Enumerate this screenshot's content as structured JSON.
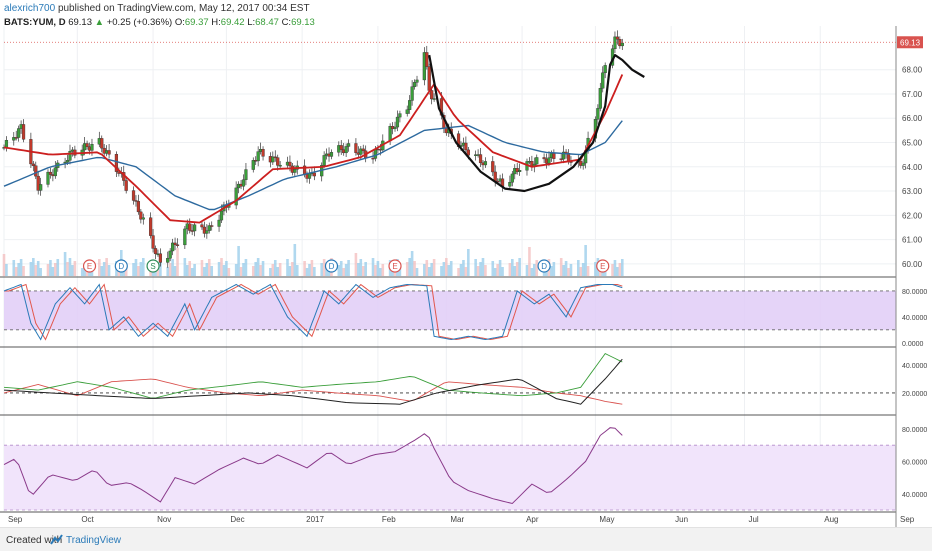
{
  "header": {
    "author": "alexrich700",
    "published": "published on TradingView.com, May 12, 2017 00:34 EST",
    "symbol": "BATS:YUM, D",
    "last": "69.13",
    "change": "+0.25 (+0.36%)",
    "open_label": "O:",
    "open": "69.37",
    "high_label": "H:",
    "high": "69.42",
    "low_label": "L:",
    "low": "68.47",
    "close_label": "C:",
    "close": "69.13"
  },
  "footer": {
    "created": "Created with",
    "brand": "TradingView"
  },
  "colors": {
    "up": "#3a9e3a",
    "down": "#c0392b",
    "ema_fast": "#cc1f1f",
    "ema_slow": "#2d6a9f",
    "cup": "#111111",
    "stoch_fill": "#e0cdf7",
    "rsi_fill": "#f1e4fb",
    "rsi_line": "#8a3a8a",
    "dmi_plus": "#3a9e3a",
    "dmi_minus": "#d9534f",
    "adx": "#222222"
  },
  "chart_data": [
    {
      "type": "candlestick",
      "name": "price",
      "y_ticks": [
        "69.13",
        "68.00",
        "67.00",
        "66.00",
        "65.00",
        "64.00",
        "63.00",
        "62.00",
        "61.00",
        "60.00"
      ],
      "last_price_label": "69.13",
      "ylim": [
        59.5,
        69.8
      ],
      "x_labels": [
        "Sep",
        "Oct",
        "Nov",
        "Dec",
        "2017",
        "Feb",
        "Mar",
        "Apr",
        "May",
        "Jun",
        "Jul",
        "Aug",
        "Sep"
      ],
      "anchors": [
        [
          "2016-09-01",
          64.8
        ],
        [
          "2016-09-08",
          65.6
        ],
        [
          "2016-09-15",
          63.2
        ],
        [
          "2016-09-29",
          64.6
        ],
        [
          "2016-10-10",
          65.0
        ],
        [
          "2016-10-18",
          63.8
        ],
        [
          "2016-10-28",
          61.8
        ],
        [
          "2016-11-04",
          60.0
        ],
        [
          "2016-11-15",
          61.5
        ],
        [
          "2016-11-24",
          61.4
        ],
        [
          "2016-12-05",
          63.0
        ],
        [
          "2016-12-14",
          64.6
        ],
        [
          "2016-12-22",
          64.2
        ],
        [
          "2017-01-05",
          63.6
        ],
        [
          "2017-01-12",
          64.6
        ],
        [
          "2017-01-20",
          64.8
        ],
        [
          "2017-01-30",
          64.4
        ],
        [
          "2017-02-06",
          65.5
        ],
        [
          "2017-02-13",
          66.5
        ],
        [
          "2017-02-20",
          68.7
        ],
        [
          "2017-02-22",
          67.2
        ],
        [
          "2017-03-01",
          65.5
        ],
        [
          "2017-03-08",
          64.8
        ],
        [
          "2017-03-16",
          64.2
        ],
        [
          "2017-03-24",
          63.2
        ],
        [
          "2017-03-31",
          64.0
        ],
        [
          "2017-04-10",
          64.3
        ],
        [
          "2017-04-18",
          64.5
        ],
        [
          "2017-04-25",
          64.0
        ],
        [
          "2017-05-01",
          66.0
        ],
        [
          "2017-05-05",
          68.3
        ],
        [
          "2017-05-09",
          69.2
        ],
        [
          "2017-05-12",
          69.13
        ]
      ],
      "ema_fast_anchors": [
        [
          "2016-09-01",
          64.8
        ],
        [
          "2016-09-20",
          64.5
        ],
        [
          "2016-10-10",
          64.6
        ],
        [
          "2016-10-25",
          63.2
        ],
        [
          "2016-11-08",
          61.8
        ],
        [
          "2016-11-20",
          61.7
        ],
        [
          "2016-12-05",
          62.6
        ],
        [
          "2016-12-20",
          63.9
        ],
        [
          "2017-01-10",
          64.0
        ],
        [
          "2017-01-25",
          64.4
        ],
        [
          "2017-02-10",
          65.3
        ],
        [
          "2017-02-24",
          67.4
        ],
        [
          "2017-03-05",
          66.0
        ],
        [
          "2017-03-20",
          64.6
        ],
        [
          "2017-04-05",
          64.0
        ],
        [
          "2017-04-25",
          64.3
        ],
        [
          "2017-05-05",
          66.2
        ],
        [
          "2017-05-12",
          67.8
        ]
      ],
      "ema_slow_anchors": [
        [
          "2016-09-01",
          63.2
        ],
        [
          "2016-09-20",
          64.0
        ],
        [
          "2016-10-10",
          64.4
        ],
        [
          "2016-10-25",
          64.0
        ],
        [
          "2016-11-10",
          62.8
        ],
        [
          "2016-11-25",
          62.2
        ],
        [
          "2016-12-10",
          62.8
        ],
        [
          "2016-12-25",
          63.5
        ],
        [
          "2017-01-15",
          64.0
        ],
        [
          "2017-02-01",
          64.5
        ],
        [
          "2017-02-20",
          65.5
        ],
        [
          "2017-03-10",
          65.7
        ],
        [
          "2017-03-25",
          65.0
        ],
        [
          "2017-04-10",
          64.6
        ],
        [
          "2017-04-25",
          64.5
        ],
        [
          "2017-05-05",
          65.0
        ],
        [
          "2017-05-12",
          65.9
        ]
      ],
      "cup_anchors": [
        [
          "2017-02-22",
          68.6
        ],
        [
          "2017-02-26",
          66.4
        ],
        [
          "2017-03-05",
          65.0
        ],
        [
          "2017-03-15",
          63.8
        ],
        [
          "2017-03-25",
          63.1
        ],
        [
          "2017-04-02",
          63.0
        ],
        [
          "2017-04-12",
          63.3
        ],
        [
          "2017-04-22",
          64.0
        ],
        [
          "2017-04-30",
          65.0
        ],
        [
          "2017-05-05",
          66.5
        ],
        [
          "2017-05-07",
          68.2
        ],
        [
          "2017-05-09",
          68.6
        ],
        [
          "2017-05-12",
          68.4
        ],
        [
          "2017-05-16",
          68.0
        ],
        [
          "2017-05-21",
          67.7
        ]
      ],
      "events": [
        {
          "date": "2016-10-06",
          "label": "E",
          "color": "#d9534f"
        },
        {
          "date": "2016-10-19",
          "label": "D",
          "color": "#2a7ab8"
        },
        {
          "date": "2016-11-01",
          "label": "S",
          "color": "#2e8b57"
        },
        {
          "date": "2017-01-13",
          "label": "D",
          "color": "#2a7ab8"
        },
        {
          "date": "2017-02-08",
          "label": "E",
          "color": "#d9534f"
        },
        {
          "date": "2017-04-10",
          "label": "D",
          "color": "#2a7ab8"
        },
        {
          "date": "2017-05-04",
          "label": "E",
          "color": "#d9534f"
        }
      ]
    },
    {
      "type": "line",
      "name": "stochastic",
      "y_ticks": [
        "80.0000",
        "40.0000",
        "0.0000"
      ],
      "ylim": [
        -5,
        100
      ],
      "band": [
        20,
        80
      ],
      "anchors": [
        [
          "2016-09-01",
          80
        ],
        [
          "2016-09-08",
          90
        ],
        [
          "2016-09-12",
          30
        ],
        [
          "2016-09-16",
          5
        ],
        [
          "2016-09-22",
          60
        ],
        [
          "2016-09-28",
          85
        ],
        [
          "2016-10-04",
          60
        ],
        [
          "2016-10-10",
          90
        ],
        [
          "2016-10-14",
          20
        ],
        [
          "2016-10-20",
          40
        ],
        [
          "2016-10-26",
          10
        ],
        [
          "2016-11-01",
          30
        ],
        [
          "2016-11-07",
          10
        ],
        [
          "2016-11-14",
          60
        ],
        [
          "2016-11-18",
          20
        ],
        [
          "2016-11-25",
          70
        ],
        [
          "2016-12-05",
          90
        ],
        [
          "2016-12-12",
          75
        ],
        [
          "2016-12-19",
          90
        ],
        [
          "2016-12-26",
          40
        ],
        [
          "2017-01-03",
          10
        ],
        [
          "2017-01-10",
          80
        ],
        [
          "2017-01-16",
          60
        ],
        [
          "2017-01-23",
          90
        ],
        [
          "2017-01-30",
          70
        ],
        [
          "2017-02-06",
          85
        ],
        [
          "2017-02-13",
          90
        ],
        [
          "2017-02-21",
          88
        ],
        [
          "2017-02-24",
          10
        ],
        [
          "2017-03-03",
          5
        ],
        [
          "2017-03-10",
          10
        ],
        [
          "2017-03-17",
          5
        ],
        [
          "2017-03-24",
          10
        ],
        [
          "2017-03-30",
          80
        ],
        [
          "2017-04-06",
          60
        ],
        [
          "2017-04-12",
          75
        ],
        [
          "2017-04-19",
          40
        ],
        [
          "2017-04-25",
          85
        ],
        [
          "2017-05-02",
          90
        ],
        [
          "2017-05-08",
          90
        ],
        [
          "2017-05-12",
          85
        ]
      ]
    },
    {
      "type": "line",
      "name": "dmi",
      "y_ticks": [
        "40.0000",
        "20.0000"
      ],
      "ylim": [
        5,
        52
      ],
      "ref_level": 20,
      "plus_anchors": [
        [
          "2016-09-01",
          24
        ],
        [
          "2016-09-15",
          22
        ],
        [
          "2016-10-01",
          28
        ],
        [
          "2016-10-15",
          24
        ],
        [
          "2016-11-01",
          16
        ],
        [
          "2016-11-15",
          22
        ],
        [
          "2016-12-01",
          25
        ],
        [
          "2016-12-15",
          28
        ],
        [
          "2017-01-01",
          24
        ],
        [
          "2017-01-15",
          26
        ],
        [
          "2017-02-01",
          28
        ],
        [
          "2017-02-15",
          32
        ],
        [
          "2017-03-01",
          22
        ],
        [
          "2017-03-15",
          20
        ],
        [
          "2017-04-01",
          18
        ],
        [
          "2017-04-15",
          20
        ],
        [
          "2017-04-25",
          24
        ],
        [
          "2017-05-05",
          48
        ],
        [
          "2017-05-12",
          42
        ]
      ],
      "minus_anchors": [
        [
          "2016-09-01",
          20
        ],
        [
          "2016-09-15",
          26
        ],
        [
          "2016-10-01",
          18
        ],
        [
          "2016-10-15",
          28
        ],
        [
          "2016-11-01",
          30
        ],
        [
          "2016-11-15",
          24
        ],
        [
          "2016-12-01",
          20
        ],
        [
          "2016-12-15",
          18
        ],
        [
          "2017-01-01",
          22
        ],
        [
          "2017-01-15",
          20
        ],
        [
          "2017-02-01",
          18
        ],
        [
          "2017-02-15",
          14
        ],
        [
          "2017-03-01",
          28
        ],
        [
          "2017-03-15",
          26
        ],
        [
          "2017-04-01",
          24
        ],
        [
          "2017-04-15",
          20
        ],
        [
          "2017-04-25",
          18
        ],
        [
          "2017-05-05",
          14
        ],
        [
          "2017-05-12",
          12
        ]
      ],
      "adx_anchors": [
        [
          "2016-09-01",
          22
        ],
        [
          "2016-09-20",
          20
        ],
        [
          "2016-10-10",
          18
        ],
        [
          "2016-11-01",
          16
        ],
        [
          "2016-11-20",
          18
        ],
        [
          "2016-12-10",
          20
        ],
        [
          "2016-12-28",
          18
        ],
        [
          "2017-01-20",
          13
        ],
        [
          "2017-02-10",
          12
        ],
        [
          "2017-02-25",
          20
        ],
        [
          "2017-03-15",
          26
        ],
        [
          "2017-03-31",
          30
        ],
        [
          "2017-04-15",
          16
        ],
        [
          "2017-04-25",
          12
        ],
        [
          "2017-05-05",
          30
        ],
        [
          "2017-05-12",
          44
        ]
      ]
    },
    {
      "type": "line",
      "name": "rsi",
      "y_ticks": [
        "80.0000",
        "60.0000",
        "40.0000"
      ],
      "ylim": [
        30,
        88
      ],
      "band": [
        30,
        70
      ],
      "anchors": [
        [
          "2016-09-01",
          58
        ],
        [
          "2016-09-06",
          62
        ],
        [
          "2016-09-12",
          38
        ],
        [
          "2016-09-20",
          52
        ],
        [
          "2016-09-30",
          48
        ],
        [
          "2016-10-08",
          55
        ],
        [
          "2016-10-14",
          45
        ],
        [
          "2016-10-22",
          47
        ],
        [
          "2016-10-28",
          42
        ],
        [
          "2016-11-04",
          35
        ],
        [
          "2016-11-10",
          50
        ],
        [
          "2016-11-18",
          46
        ],
        [
          "2016-11-28",
          55
        ],
        [
          "2016-12-08",
          62
        ],
        [
          "2016-12-15",
          58
        ],
        [
          "2016-12-22",
          64
        ],
        [
          "2017-01-03",
          56
        ],
        [
          "2017-01-12",
          66
        ],
        [
          "2017-01-20",
          58
        ],
        [
          "2017-01-30",
          64
        ],
        [
          "2017-02-08",
          66
        ],
        [
          "2017-02-16",
          73
        ],
        [
          "2017-02-21",
          78
        ],
        [
          "2017-02-24",
          68
        ],
        [
          "2017-03-03",
          48
        ],
        [
          "2017-03-10",
          42
        ],
        [
          "2017-03-20",
          37
        ],
        [
          "2017-03-28",
          34
        ],
        [
          "2017-04-05",
          46
        ],
        [
          "2017-04-12",
          40
        ],
        [
          "2017-04-20",
          50
        ],
        [
          "2017-04-27",
          60
        ],
        [
          "2017-05-03",
          76
        ],
        [
          "2017-05-08",
          82
        ],
        [
          "2017-05-12",
          76
        ]
      ]
    }
  ]
}
